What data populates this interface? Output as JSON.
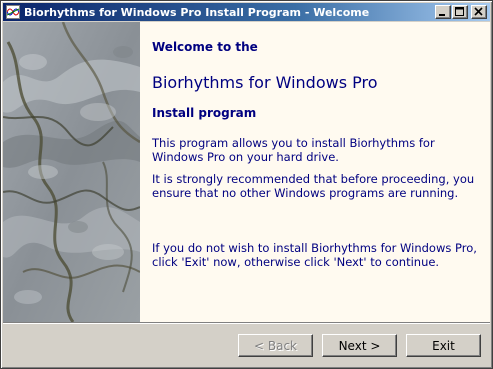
{
  "window": {
    "title": "Biorhythms for Windows Pro Install Program - Welcome",
    "app_icon": "biorhythm-chart-icon",
    "title_buttons": [
      "minimize-icon",
      "maximize-icon",
      "close-icon"
    ]
  },
  "content": {
    "welcome": "Welcome to the",
    "product": "Biorhythms for Windows Pro",
    "section": "Install program",
    "paragraph1": "This program allows you to install Biorhythms for Windows Pro on your hard drive.",
    "paragraph2": "It is strongly recommended that before proceeding, you ensure that no other Windows programs are running.",
    "paragraph3": "If you do not wish to install Biorhythms for Windows Pro, click 'Exit' now, otherwise click 'Next' to continue."
  },
  "buttons": {
    "back": "< Back",
    "back_enabled": false,
    "next": "Next >",
    "exit": "Exit"
  },
  "colors": {
    "title_start": "#0a246a",
    "title_end": "#a6caf0",
    "text": "#000080",
    "panel": "#fffaf0",
    "face": "#d4d0c8"
  }
}
